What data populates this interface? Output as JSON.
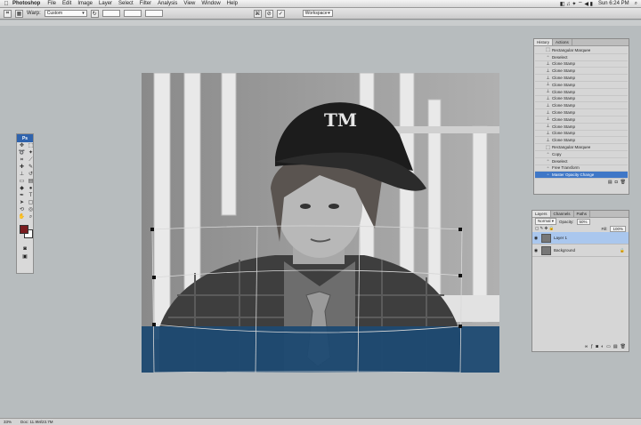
{
  "menubar": {
    "app": "Photoshop",
    "items": [
      "File",
      "Edit",
      "Image",
      "Layer",
      "Select",
      "Filter",
      "Analysis",
      "View",
      "Window",
      "Help"
    ],
    "clock": "Sun 6:24 PM"
  },
  "options": {
    "warp_label": "Warp:",
    "warp_value": "Custom",
    "workspace": "Workspace"
  },
  "history": {
    "tabs": [
      "History",
      "Actions"
    ],
    "items": [
      {
        "label": "Rectangular Marquee",
        "icon": "marquee-icon"
      },
      {
        "label": "Deselect",
        "icon": "document-icon"
      },
      {
        "label": "Clone Stamp",
        "icon": "stamp-icon"
      },
      {
        "label": "Clone Stamp",
        "icon": "stamp-icon"
      },
      {
        "label": "Clone Stamp",
        "icon": "stamp-icon"
      },
      {
        "label": "Clone Stamp",
        "icon": "stamp-icon"
      },
      {
        "label": "Clone Stamp",
        "icon": "stamp-icon"
      },
      {
        "label": "Clone Stamp",
        "icon": "stamp-icon"
      },
      {
        "label": "Clone Stamp",
        "icon": "stamp-icon"
      },
      {
        "label": "Clone Stamp",
        "icon": "stamp-icon"
      },
      {
        "label": "Clone Stamp",
        "icon": "stamp-icon"
      },
      {
        "label": "Clone Stamp",
        "icon": "stamp-icon"
      },
      {
        "label": "Clone Stamp",
        "icon": "stamp-icon"
      },
      {
        "label": "Clone Stamp",
        "icon": "stamp-icon"
      },
      {
        "label": "Rectangular Marquee",
        "icon": "marquee-icon"
      },
      {
        "label": "Copy",
        "icon": "document-icon"
      },
      {
        "label": "Deselect",
        "icon": "document-icon"
      },
      {
        "label": "Free Transform",
        "icon": "document-icon"
      },
      {
        "label": "Master Opacity Change",
        "icon": "document-icon",
        "selected": true
      }
    ]
  },
  "layers": {
    "tabs": [
      "Layers",
      "Channels",
      "Paths"
    ],
    "blend_mode": "Normal",
    "opacity_label": "Opacity:",
    "opacity_value": "50%",
    "fill_label": "Fill:",
    "fill_value": "100%",
    "items": [
      {
        "name": "Layer 1",
        "selected": true
      },
      {
        "name": "Background",
        "locked": true
      }
    ]
  },
  "status": {
    "zoom": "33%",
    "doc": "Doc: 11.9M/23.7M"
  },
  "colors": {
    "foreground": "#7a1c1f",
    "background": "#ffffff",
    "overlay": "#1d4a72",
    "selection": "#3f77c7"
  }
}
